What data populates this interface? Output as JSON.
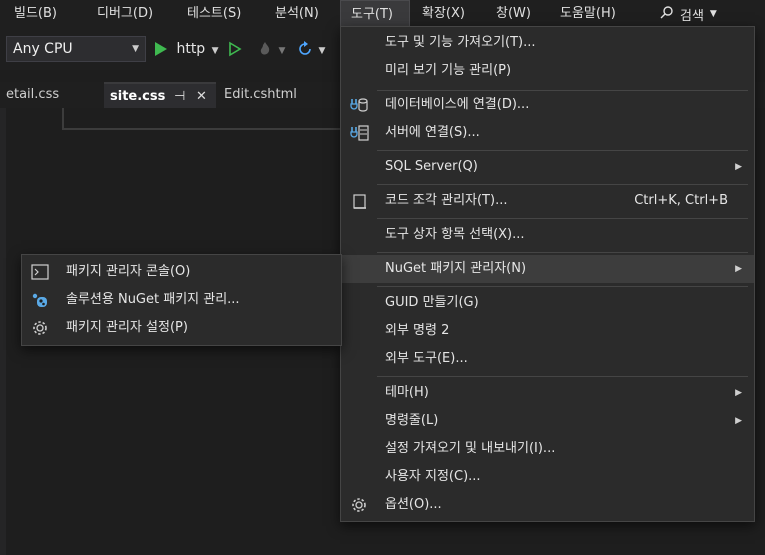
{
  "menubar": {
    "items": [
      {
        "label": "빌드(B)"
      },
      {
        "label": "디버그(D)"
      },
      {
        "label": "테스트(S)"
      },
      {
        "label": "분석(N)"
      },
      {
        "label": "도구(T)",
        "active": true
      },
      {
        "label": "확장(X)"
      },
      {
        "label": "창(W)"
      },
      {
        "label": "도움말(H)"
      }
    ],
    "search_label": "검색"
  },
  "toolbar": {
    "platform_value": "Any CPU",
    "run_target": "http"
  },
  "tabs": [
    {
      "label": "etail.css"
    },
    {
      "label": "site.css",
      "active": true
    },
    {
      "label": "Edit.cshtml"
    }
  ],
  "tools_menu": {
    "items": [
      {
        "label": "도구 및 기능 가져오기(T)..."
      },
      {
        "label": "미리 보기 기능 관리(P)"
      },
      {
        "label": "데이터베이스에 연결(D)...",
        "icon": "database-connect-icon"
      },
      {
        "label": "서버에 연결(S)...",
        "icon": "server-connect-icon"
      },
      {
        "label": "SQL Server(Q)",
        "submenu": true
      },
      {
        "label": "코드 조각 관리자(T)...",
        "shortcut": "Ctrl+K, Ctrl+B",
        "icon": "snippet-icon"
      },
      {
        "label": "도구 상자 항목 선택(X)..."
      },
      {
        "label": "NuGet 패키지 관리자(N)",
        "submenu": true,
        "highlighted": true
      },
      {
        "label": "GUID 만들기(G)"
      },
      {
        "label": "외부 명령 2"
      },
      {
        "label": "외부 도구(E)..."
      },
      {
        "label": "테마(H)",
        "submenu": true
      },
      {
        "label": "명령줄(L)",
        "submenu": true
      },
      {
        "label": "설정 가져오기 및 내보내기(I)..."
      },
      {
        "label": "사용자 지정(C)..."
      },
      {
        "label": "옵션(O)...",
        "icon": "gear-icon"
      }
    ]
  },
  "nuget_submenu": {
    "items": [
      {
        "label": "패키지 관리자 콘솔(O)",
        "icon": "console-icon"
      },
      {
        "label": "솔루션용 NuGet 패키지 관리...",
        "icon": "nuget-icon"
      },
      {
        "label": "패키지 관리자 설정(P)",
        "icon": "gear-icon"
      }
    ]
  }
}
